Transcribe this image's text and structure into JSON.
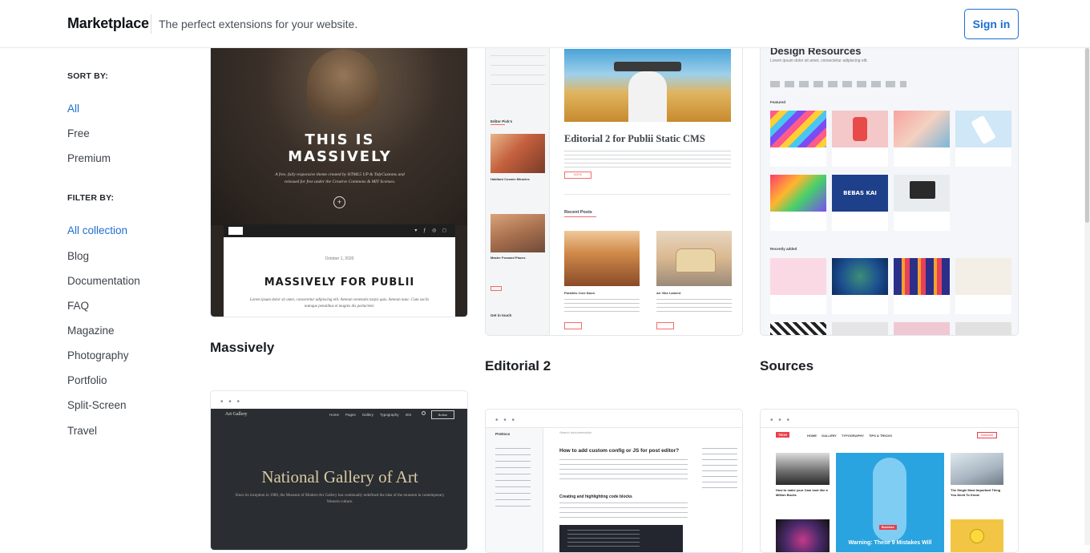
{
  "header": {
    "brand": "Marketplace",
    "tagline": "The perfect extensions for your website.",
    "signin_label": "Sign in"
  },
  "sidebar": {
    "sort_heading": "SORT BY:",
    "sort_items": [
      "All",
      "Free",
      "Premium"
    ],
    "filter_heading": "FILTER BY:",
    "filter_items": [
      "All collection",
      "Blog",
      "Documentation",
      "FAQ",
      "Magazine",
      "Photography",
      "Portfolio",
      "Split-Screen",
      "Travel"
    ]
  },
  "cards": [
    {
      "title": "Massively",
      "preview": {
        "hero_line1": "THIS IS",
        "hero_line2": "MASSIVELY",
        "hero_sub": "A free, fully responsive theme created by HTML5 UP & TidyCustoms and released for free under the Creative Commons & MIT licenses.",
        "date": "October 1, 2020",
        "post_title": "MASSIVELY FOR PUBLII",
        "post_text": "Lorem ipsum dolor sit amet, consectetur adipiscing elit. Aenean venenatis turpis quis. Aenean nunc. Cum sociis natoque penatibus et magnis dis parturient."
      }
    },
    {
      "title": "Editorial 2",
      "preview": {
        "headline": "Editorial 2 for Publii Static CMS",
        "editor_picks": "Editor Pick's",
        "recent_posts": "Recent Posts",
        "post1": "Parallels Core Noon",
        "post2": "An Vibe Lament",
        "side_post1": "Habitant Cosmic Miracles",
        "side_post2": "Master Forward Places",
        "get_in_touch": "Get in touch",
        "more": "MORE"
      }
    },
    {
      "title": "Sources",
      "preview": {
        "heading": "Design Resources",
        "sub": "Lorem ipsum dolor sit amet, consectetur adipiscing elit.",
        "featured": "Featured",
        "recently": "Recently added",
        "bebas": "BEBAS KAI"
      }
    },
    {
      "title": "",
      "preview": {
        "site": "Art Gallery",
        "nav": [
          "Home",
          "Pages",
          "Gallery",
          "Typography",
          "404"
        ],
        "button": "Button",
        "hero_title": "National Gallery of Art",
        "hero_text": "Since its inception in 1980, the Museum of Modern Art Gallery has continually redefined the idea of the museum in contemporary Western culture."
      }
    },
    {
      "title": "",
      "preview": {
        "logo": "PreDocs",
        "search": "Search documentation",
        "doc_title": "How to add custom config or JS for post editor?",
        "section": "Creating and highlighting code blocks"
      }
    },
    {
      "title": "",
      "preview": {
        "logo": "TECH",
        "nav": [
          "HOME",
          "GALLERY",
          "TYPOGRAPHY",
          "TIPS & TRICKS"
        ],
        "subscribe": "Subscribe",
        "left_caption": "How to make your Cam look like a Million Bucks",
        "right_caption": "The Single Most Important Thing You Need To Know",
        "badge": "Business",
        "feature": "Warning: These 9 Mistakes Will"
      }
    }
  ],
  "colors": {
    "accent": "#1d6fd1",
    "text": "#1f2329",
    "border": "#e3e6ea"
  }
}
